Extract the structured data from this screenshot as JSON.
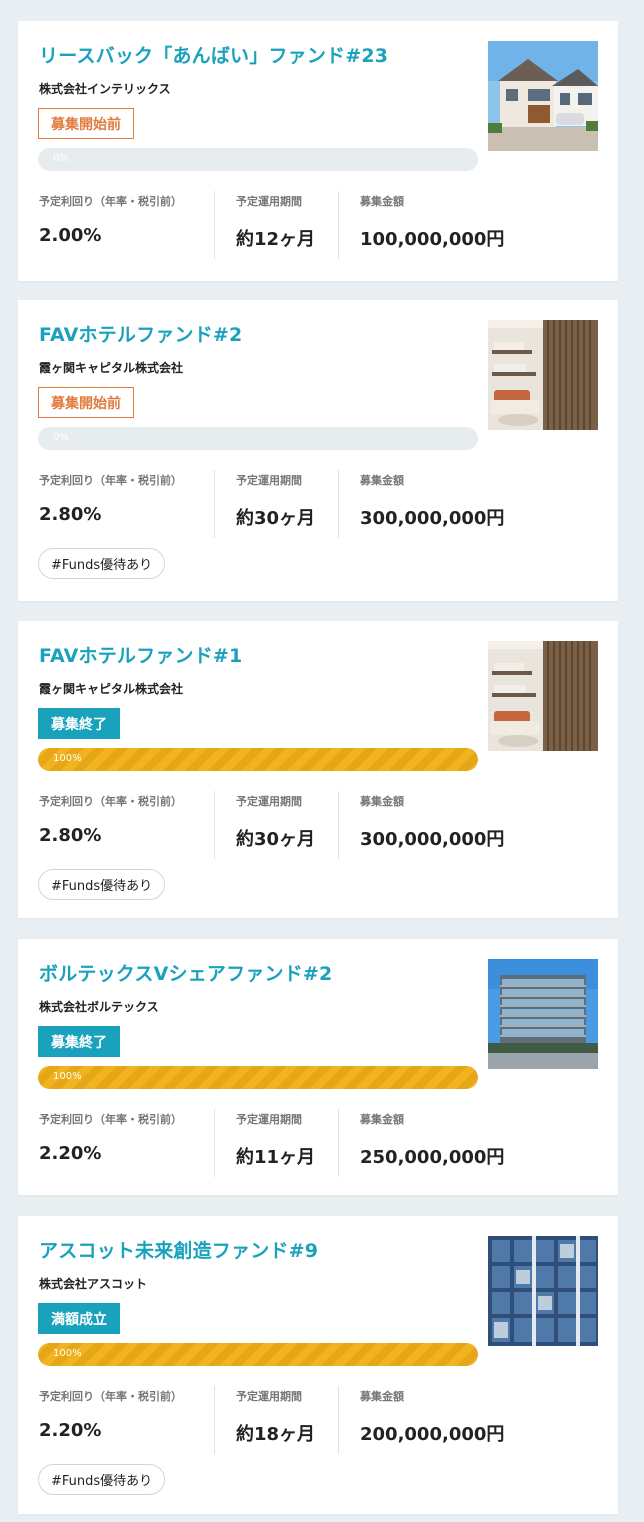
{
  "funds": [
    {
      "title": "リースバック「あんばい」ファンド#23",
      "company": "株式会社インテリックス",
      "status": "募集開始前",
      "status_type": "pre",
      "progress_label": "0%",
      "progress": 0,
      "yield_label": "予定利回り（年率・税引前）",
      "yield_value": "2.00%",
      "period_label": "予定運用期間",
      "period_value": "約12ヶ月",
      "amount_label": "募集金額",
      "amount_value": "100,000,000円",
      "tag": null,
      "image": "house"
    },
    {
      "title": "FAVホテルファンド#2",
      "company": "霞ヶ関キャピタル株式会社",
      "status": "募集開始前",
      "status_type": "pre",
      "progress_label": "0%",
      "progress": 0,
      "yield_label": "予定利回り（年率・税引前）",
      "yield_value": "2.80%",
      "period_label": "予定運用期間",
      "period_value": "約30ヶ月",
      "amount_label": "募集金額",
      "amount_value": "300,000,000円",
      "tag": "#Funds優待あり",
      "image": "hotel"
    },
    {
      "title": "FAVホテルファンド#1",
      "company": "霞ヶ関キャピタル株式会社",
      "status": "募集終了",
      "status_type": "done",
      "progress_label": "100%",
      "progress": 100,
      "yield_label": "予定利回り（年率・税引前）",
      "yield_value": "2.80%",
      "period_label": "予定運用期間",
      "period_value": "約30ヶ月",
      "amount_label": "募集金額",
      "amount_value": "300,000,000円",
      "tag": "#Funds優待あり",
      "image": "hotel"
    },
    {
      "title": "ボルテックスVシェアファンド#2",
      "company": "株式会社ボルテックス",
      "status": "募集終了",
      "status_type": "done",
      "progress_label": "100%",
      "progress": 100,
      "yield_label": "予定利回り（年率・税引前）",
      "yield_value": "2.20%",
      "period_label": "予定運用期間",
      "period_value": "約11ヶ月",
      "amount_label": "募集金額",
      "amount_value": "250,000,000円",
      "tag": null,
      "image": "office"
    },
    {
      "title": "アスコット未来創造ファンド#9",
      "company": "株式会社アスコット",
      "status": "満額成立",
      "status_type": "done",
      "progress_label": "100%",
      "progress": 100,
      "yield_label": "予定利回り（年率・税引前）",
      "yield_value": "2.20%",
      "period_label": "予定運用期間",
      "period_value": "約18ヶ月",
      "amount_label": "募集金額",
      "amount_value": "200,000,000円",
      "tag": "#Funds優待あり",
      "image": "apartment"
    }
  ],
  "colors": {
    "title": "#1aa2bd",
    "status_pre": "#e07c3e",
    "status_done": "#1aa2bd",
    "progress": "#f1b320"
  }
}
